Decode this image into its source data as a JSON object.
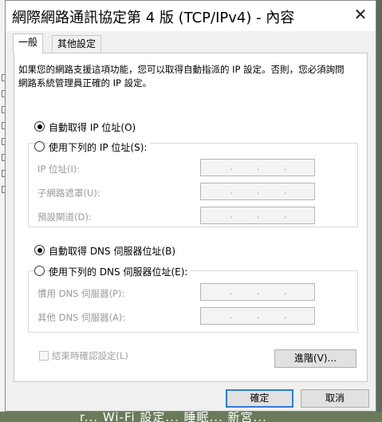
{
  "background": {
    "bottom_text": "r... Wi-Fi 設定... 睡眠... 新宮..."
  },
  "dialog": {
    "title": "網際網路通訊協定第 4 版 (TCP/IPv4) - 內容",
    "close_glyph": "✕"
  },
  "tabs": [
    {
      "label": "一般",
      "active": true
    },
    {
      "label": "其他設定",
      "active": false
    }
  ],
  "general": {
    "description": "如果您的網路支援這項功能，您可以取得自動指派的 IP 設定。否則，您必須詢問網路系統管理員正確的 IP 設定。",
    "ip_auto_label": "自動取得 IP 位址(O)",
    "ip_manual_label": "使用下列的 IP 位址(S):",
    "ip_address_label": "IP 位址(I):",
    "subnet_label": "子網路遮罩(U):",
    "gateway_label": "預設閘道(D):",
    "dns_auto_label": "自動取得 DNS 伺服器位址(B)",
    "dns_manual_label": "使用下列的 DNS 伺服器位址(E):",
    "dns_preferred_label": "慣用 DNS 伺服器(P):",
    "dns_alternate_label": "其他 DNS 伺服器(A):",
    "validate_label": "結束時確認設定(L)",
    "advanced_label": "進階(V)...",
    "ip_dot": "."
  },
  "footer": {
    "ok_label": "確定",
    "cancel_label": "取消"
  },
  "colors": {
    "accent": "#2f7bd6",
    "disabled_text": "#9a9a9a"
  }
}
